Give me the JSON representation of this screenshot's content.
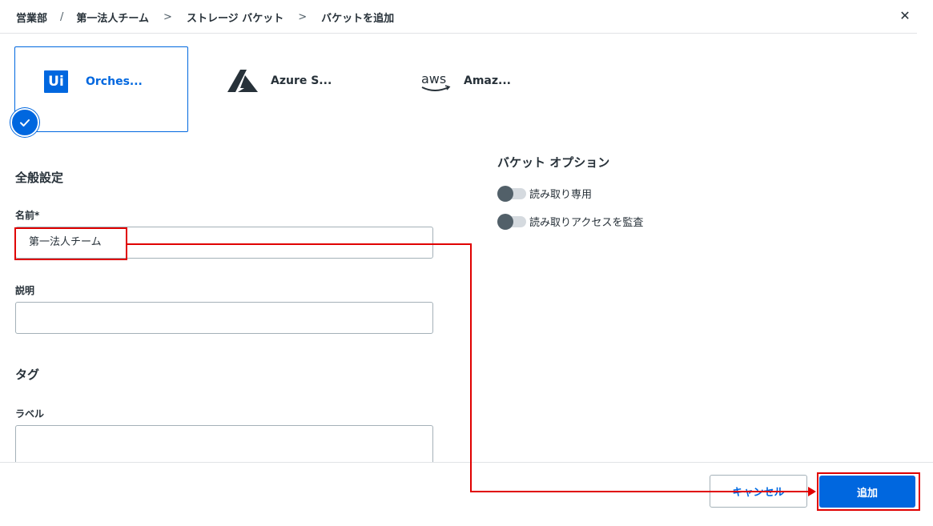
{
  "breadcrumb": {
    "items": [
      "営業部",
      "第一法人チーム",
      "ストレージ バケット",
      "バケットを追加"
    ],
    "separators": [
      "/",
      ">",
      ">"
    ]
  },
  "close_label": "✕",
  "providers": [
    {
      "logo_text": "Ui",
      "label": "Orches...",
      "selected": true
    },
    {
      "label": "Azure S...",
      "selected": false
    },
    {
      "logo_text": "aws",
      "label": "Amaz...",
      "selected": false
    }
  ],
  "general": {
    "title": "全般設定",
    "name_label": "名前*",
    "name_value": "第一法人チーム",
    "description_label": "説明",
    "description_value": ""
  },
  "tags": {
    "title": "タグ",
    "label_label": "ラベル",
    "label_value": ""
  },
  "bucket_options": {
    "title": "バケット オプション",
    "toggles": [
      {
        "label": "読み取り専用",
        "on": false
      },
      {
        "label": "読み取りアクセスを監査",
        "on": false
      }
    ]
  },
  "footer": {
    "cancel_label": "キャンセル",
    "add_label": "追加"
  },
  "colors": {
    "accent": "#0067df",
    "annotation": "#e00000"
  }
}
